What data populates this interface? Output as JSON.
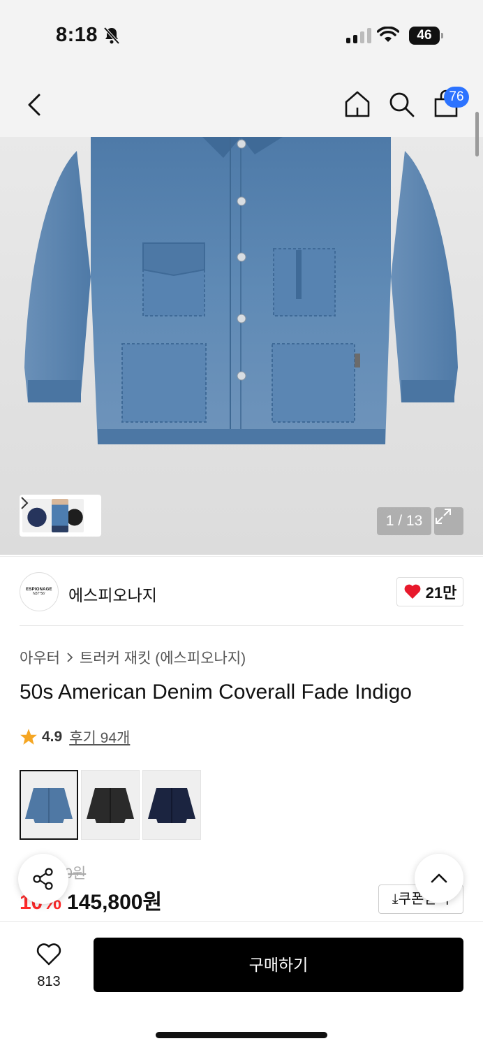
{
  "status_bar": {
    "time": "8:18",
    "battery": "46"
  },
  "nav": {
    "cart_count": "76"
  },
  "gallery": {
    "page_indicator": "1 / 13",
    "current_page": 1,
    "total_pages": 13
  },
  "brand": {
    "logo_line1": "ESPIONAGE",
    "logo_line2": "N37°56'",
    "name": "에스피오나지",
    "likes": "21만"
  },
  "product": {
    "breadcrumb": [
      "아우터",
      "트러커 재킷 (에스피오나지)"
    ],
    "title": "50s American Denim Coverall Fade Indigo",
    "rating": "4.9",
    "reviews": "후기 94개",
    "color_options": [
      {
        "name": "fade-indigo",
        "color": "#4f78a4",
        "selected": true
      },
      {
        "name": "black",
        "color": "#2a2a2a",
        "selected": false
      },
      {
        "name": "navy",
        "color": "#1b2440",
        "selected": false
      }
    ],
    "original_price": "162,000원",
    "discount": "10%",
    "sale_price": "145,800원",
    "coupon_label": "⤓쿠폰받기"
  },
  "bottom_bar": {
    "wish_count": "813",
    "buy_label": "구매하기"
  },
  "colors": {
    "accent_blue": "#2c73ff",
    "discount_red": "#ff2a2a",
    "heart_red": "#e8192c",
    "star": "#f5a623",
    "denim": "#5a83b0"
  }
}
